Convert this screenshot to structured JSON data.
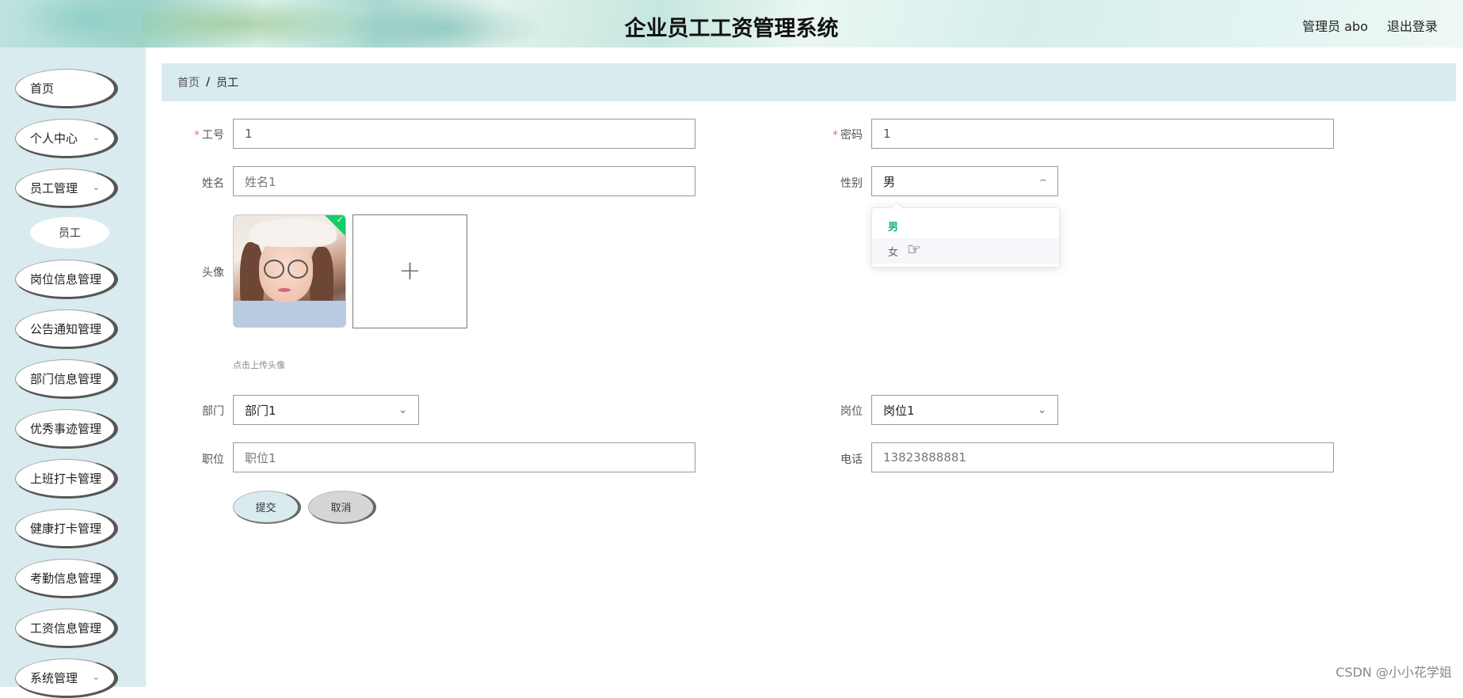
{
  "header": {
    "title": "企业员工工资管理系统",
    "user": "管理员 abo",
    "logout": "退出登录"
  },
  "sidebar": {
    "items": [
      {
        "label": "首页"
      },
      {
        "label": "个人中心",
        "expand_icon": "chevron-down-icon"
      },
      {
        "label": "员工管理",
        "expand_icon": "chevron-down-icon"
      },
      {
        "label": "员工"
      },
      {
        "label": "岗位信息管理"
      },
      {
        "label": "公告通知管理"
      },
      {
        "label": "部门信息管理"
      },
      {
        "label": "优秀事迹管理"
      },
      {
        "label": "上班打卡管理"
      },
      {
        "label": "健康打卡管理"
      },
      {
        "label": "考勤信息管理"
      },
      {
        "label": "工资信息管理"
      },
      {
        "label": "系统管理",
        "expand_icon": "chevron-down-icon"
      }
    ]
  },
  "breadcrumb": {
    "home": "首页",
    "separator": "/",
    "current": "员工"
  },
  "form": {
    "required_mark": "*",
    "employee_no": {
      "label": "工号",
      "value": "1"
    },
    "password": {
      "label": "密码",
      "value": "1"
    },
    "name": {
      "label": "姓名",
      "value": "姓名1"
    },
    "gender": {
      "label": "性别",
      "value": "男",
      "options": [
        "男",
        "女"
      ]
    },
    "avatar": {
      "label": "头像",
      "tip": "点击上传头像",
      "upload_icon": "plus-icon"
    },
    "department": {
      "label": "部门",
      "value": "部门1"
    },
    "post": {
      "label": "岗位",
      "value": "岗位1"
    },
    "position": {
      "label": "职位",
      "value": "职位1"
    },
    "phone": {
      "label": "电话",
      "value": "13823888881"
    },
    "submit": "提交",
    "cancel": "取消"
  },
  "watermark": "CSDN @小小花学姐",
  "colors": {
    "accent": "#13b48c",
    "sidebar_bg": "#d9ebee",
    "success_badge": "#13ce66",
    "required": "#f56c6c"
  }
}
